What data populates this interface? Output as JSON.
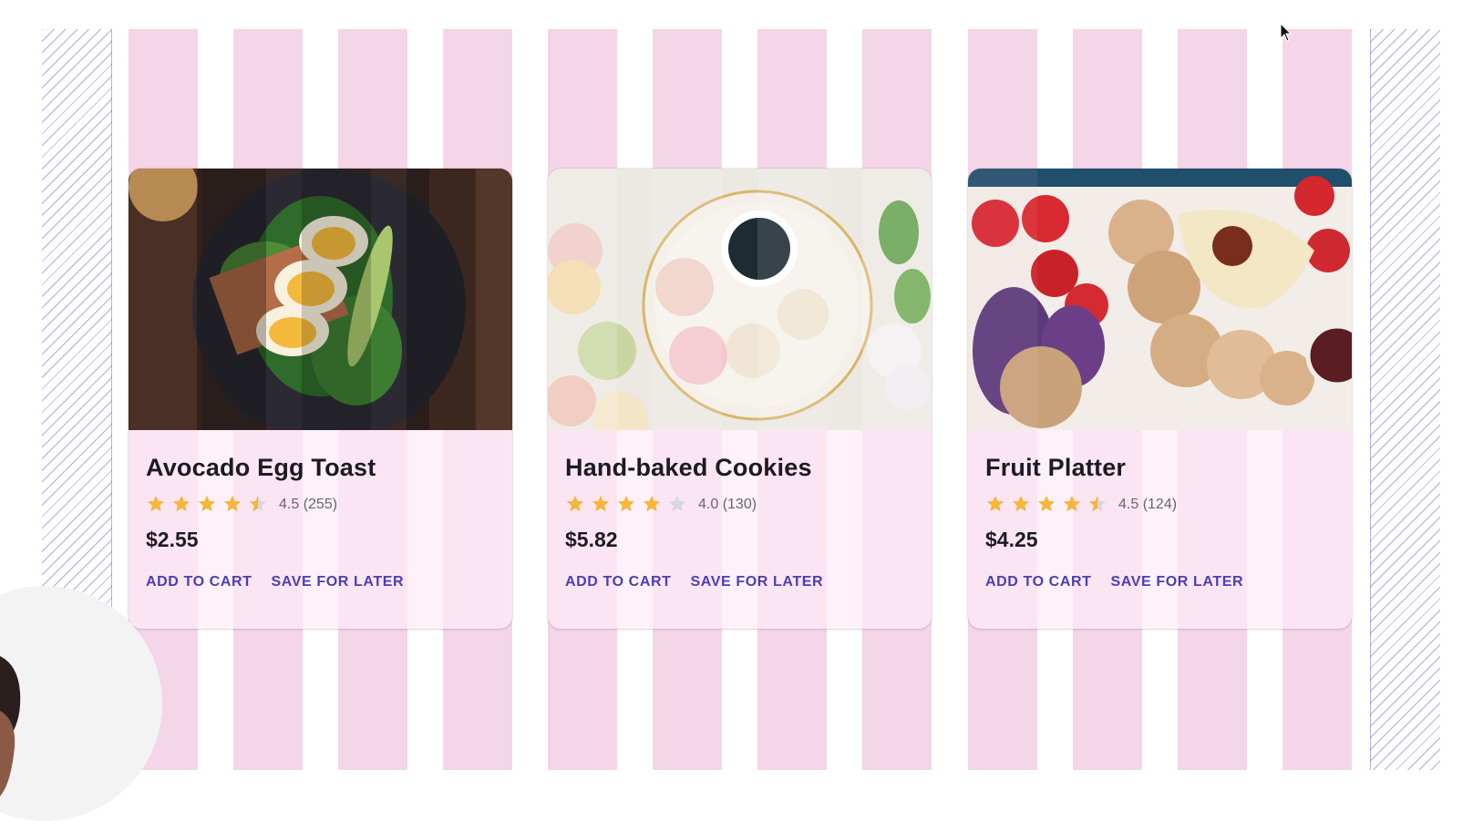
{
  "products": [
    {
      "title": "Avocado Egg Toast",
      "rating": 4.5,
      "rating_text": "4.5 (255)",
      "price": "$2.55",
      "image_icon": "avocado-egg-toast-photo",
      "actions": {
        "add": "ADD TO CART",
        "save": "SAVE FOR LATER"
      }
    },
    {
      "title": "Hand-baked Cookies",
      "rating": 4.0,
      "rating_text": "4.0 (130)",
      "price": "$5.82",
      "image_icon": "macarons-coffee-photo",
      "actions": {
        "add": "ADD TO CART",
        "save": "SAVE FOR LATER"
      }
    },
    {
      "title": "Fruit Platter",
      "rating": 4.5,
      "rating_text": "4.5 (124)",
      "price": "$4.25",
      "image_icon": "fruit-cracker-platter-photo",
      "actions": {
        "add": "ADD TO CART",
        "save": "SAVE FOR LATER"
      }
    }
  ],
  "colors": {
    "stripe": "#f5d5e8",
    "star": "#f4b73a",
    "star_empty": "#d9d6dc",
    "action": "#4a3fb3",
    "hatch": "#6464dc"
  }
}
